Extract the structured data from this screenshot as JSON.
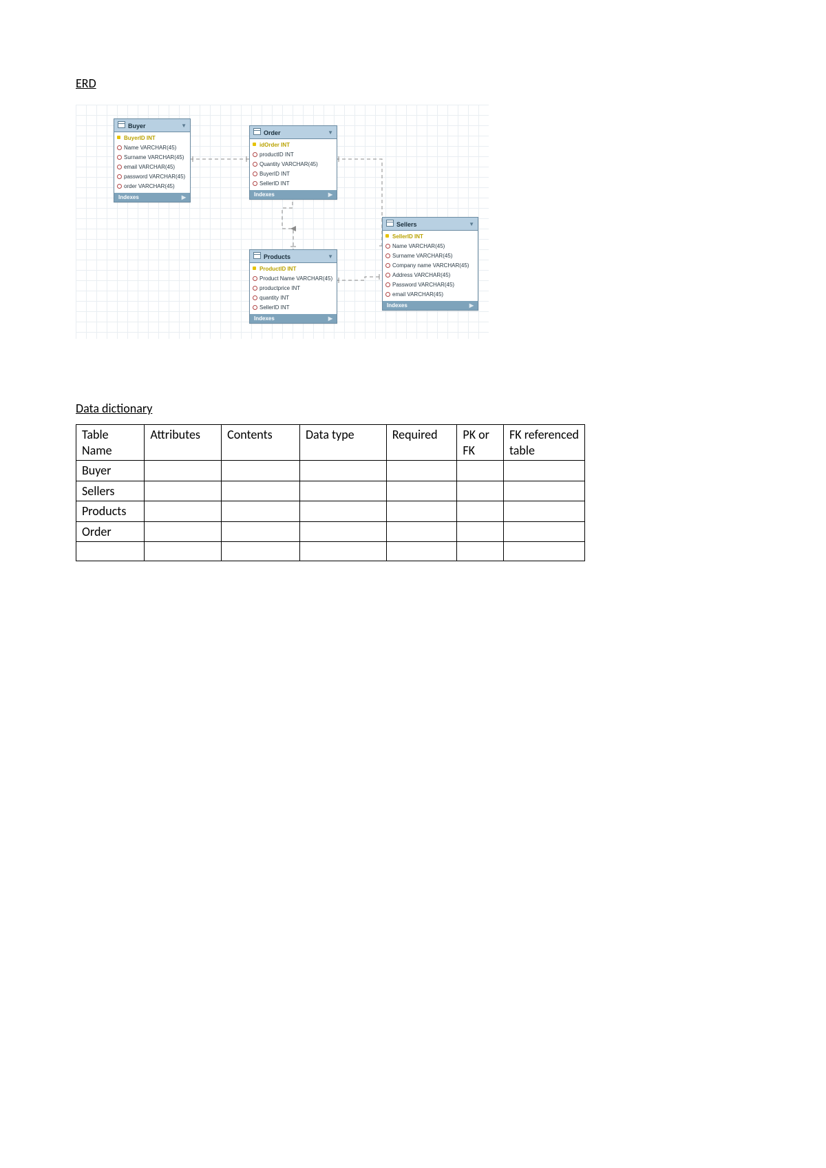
{
  "erd": {
    "heading": "ERD",
    "entities": {
      "buyer": {
        "title": "Buyer",
        "attrs": [
          {
            "text": "BuyerID INT",
            "pk": true
          },
          {
            "text": "Name VARCHAR(45)",
            "pk": false
          },
          {
            "text": "Surname VARCHAR(45)",
            "pk": false
          },
          {
            "text": "email VARCHAR(45)",
            "pk": false
          },
          {
            "text": "password VARCHAR(45)",
            "pk": false
          },
          {
            "text": "order VARCHAR(45)",
            "pk": false
          }
        ],
        "indexes": "Indexes"
      },
      "order": {
        "title": "Order",
        "attrs": [
          {
            "text": "idOrder INT",
            "pk": true
          },
          {
            "text": "productID INT",
            "pk": false
          },
          {
            "text": "Quantity VARCHAR(45)",
            "pk": false
          },
          {
            "text": "BuyerID INT",
            "pk": false
          },
          {
            "text": "SellerID INT",
            "pk": false
          }
        ],
        "indexes": "Indexes"
      },
      "products": {
        "title": "Products",
        "attrs": [
          {
            "text": "ProductID INT",
            "pk": true
          },
          {
            "text": "Product Name VARCHAR(45)",
            "pk": false
          },
          {
            "text": "productprice INT",
            "pk": false
          },
          {
            "text": "quantity INT",
            "pk": false
          },
          {
            "text": "SellerID INT",
            "pk": false
          }
        ],
        "indexes": "Indexes"
      },
      "sellers": {
        "title": "Sellers",
        "attrs": [
          {
            "text": "SellerID INT",
            "pk": true
          },
          {
            "text": "Name VARCHAR(45)",
            "pk": false
          },
          {
            "text": "Surname VARCHAR(45)",
            "pk": false
          },
          {
            "text": "Company name VARCHAR(45)",
            "pk": false
          },
          {
            "text": "Address VARCHAR(45)",
            "pk": false
          },
          {
            "text": "Password VARCHAR(45)",
            "pk": false
          },
          {
            "text": "email VARCHAR(45)",
            "pk": false
          }
        ],
        "indexes": "Indexes"
      }
    }
  },
  "dictionary": {
    "heading": "Data dictionary",
    "headers": {
      "c1": "Table Name",
      "c2": "Attributes",
      "c3": "Contents",
      "c4": "Data type",
      "c5": "Required",
      "c6": "PK or FK",
      "c7": "FK referenced table"
    },
    "rows": [
      {
        "name": "Buyer"
      },
      {
        "name": "Sellers"
      },
      {
        "name": "Products"
      },
      {
        "name": "Order"
      },
      {
        "name": ""
      }
    ]
  }
}
